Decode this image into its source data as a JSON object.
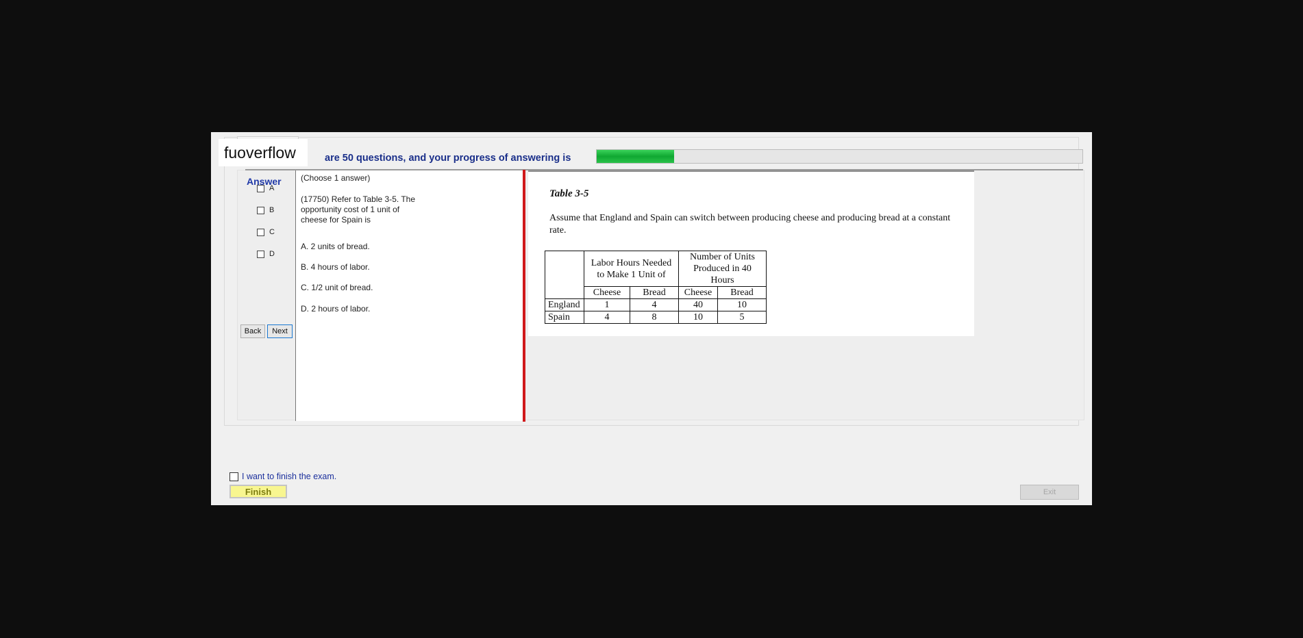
{
  "watermark": "fuoverflow",
  "progress": {
    "text": "are 50 questions, and your progress of answering is",
    "fraction": 0.16
  },
  "answer": {
    "heading": "Answer",
    "options": [
      "A",
      "B",
      "C",
      "D"
    ]
  },
  "nav": {
    "back_label": "Back",
    "next_label": "Next"
  },
  "question": {
    "instruction": "(Choose 1 answer)",
    "stem_lines": [
      "(17750)  Refer to Table 3-5.  The",
      "opportunity cost of 1 unit of",
      "cheese for Spain is"
    ],
    "choices": [
      "A.  2 units of bread.",
      "B.  4 hours of labor.",
      "C.  1/2 unit of bread.",
      "D.  2 hours of labor."
    ]
  },
  "reference": {
    "title": "Table 3-5",
    "body": "Assume that England and Spain can switch between producing cheese and producing bread at a constant rate.",
    "table": {
      "group_headers": [
        "Labor Hours Needed to Make 1 Unit of",
        "Number of Units Produced in 40 Hours"
      ],
      "group_header_lines": [
        [
          "Labor Hours Needed",
          "to Make 1 Unit of"
        ],
        [
          "Number of Units",
          "Produced in 40 Hours"
        ]
      ],
      "subheaders": [
        "Cheese",
        "Bread",
        "Cheese",
        "Bread"
      ],
      "rows": [
        {
          "name": "England",
          "values": [
            "1",
            "4",
            "40",
            "10"
          ]
        },
        {
          "name": "Spain",
          "values": [
            "4",
            "8",
            "10",
            "5"
          ]
        }
      ]
    }
  },
  "footer": {
    "finish_checkbox_label": "I want to finish the exam.",
    "finish_label": "Finish",
    "exit_label": "Exit"
  },
  "colors": {
    "accent_blue": "#1a2f8a",
    "progress_green": "#10a832",
    "divider_red": "#d0191b",
    "finish_yellow": "#f8f690"
  }
}
